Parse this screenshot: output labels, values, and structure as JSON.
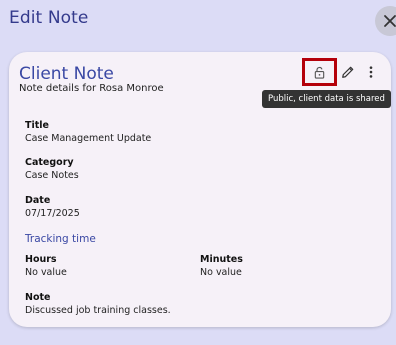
{
  "header": {
    "title": "Edit Note"
  },
  "card": {
    "title": "Client Note",
    "subtitle": "Note details for Rosa Monroe",
    "tooltip": "Public, client data is shared",
    "fields": {
      "title_label": "Title",
      "title_value": "Case Management Update",
      "category_label": "Category",
      "category_value": "Case Notes",
      "date_label": "Date",
      "date_value": "07/17/2025",
      "tracking_label": "Tracking time",
      "hours_label": "Hours",
      "hours_value": "No value",
      "minutes_label": "Minutes",
      "minutes_value": "No value",
      "note_label": "Note",
      "note_value": "Discussed job training classes."
    }
  },
  "icons": {
    "close": "close-icon",
    "lock": "lock-open-icon",
    "edit": "pencil-icon",
    "more": "more-vertical-icon"
  },
  "colors": {
    "background": "#dcdcf6",
    "accent": "#3a48a4",
    "highlight": "#b4000a",
    "card": "#f6f1f8"
  }
}
